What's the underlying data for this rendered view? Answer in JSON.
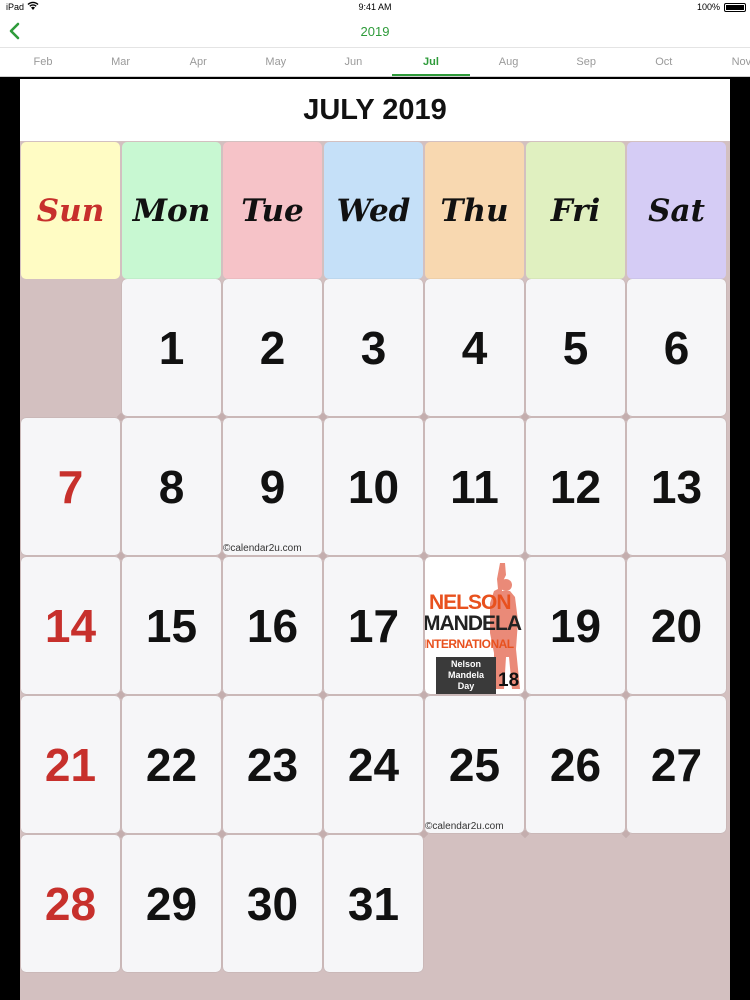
{
  "status_bar": {
    "carrier": "iPad",
    "time": "9:41 AM",
    "battery": "100%"
  },
  "nav": {
    "title": "2019"
  },
  "months": [
    "Feb",
    "Mar",
    "Apr",
    "May",
    "Jun",
    "Jul",
    "Aug",
    "Sep",
    "Oct",
    "Nov"
  ],
  "active_month": "Jul",
  "calendar": {
    "title": "JULY 2019",
    "weekdays": [
      {
        "label": "Sun",
        "color": "#fffcc4"
      },
      {
        "label": "Mon",
        "color": "#c8f8d2"
      },
      {
        "label": "Tue",
        "color": "#f6c3c8"
      },
      {
        "label": "Wed",
        "color": "#c5e0f8"
      },
      {
        "label": "Thu",
        "color": "#f8d8b0"
      },
      {
        "label": "Fri",
        "color": "#e0f0c0"
      },
      {
        "label": "Sat",
        "color": "#d5ccf5"
      }
    ],
    "days": [
      "1",
      "2",
      "3",
      "4",
      "5",
      "6",
      "7",
      "8",
      "9",
      "10",
      "11",
      "12",
      "13",
      "14",
      "15",
      "16",
      "17",
      "18",
      "19",
      "20",
      "21",
      "22",
      "23",
      "24",
      "25",
      "26",
      "27",
      "28",
      "29",
      "30",
      "31"
    ],
    "watermark": "©calendar2u.com",
    "event": {
      "nelson": "NELSON",
      "mandela": "MANDELA",
      "international": "INTERNATIONAL",
      "label": "Nelson Mandela Day"
    },
    "sunday_color": "#c7302c",
    "background_color": "#d3c0c0"
  },
  "accent_color": "#2e9b3a"
}
